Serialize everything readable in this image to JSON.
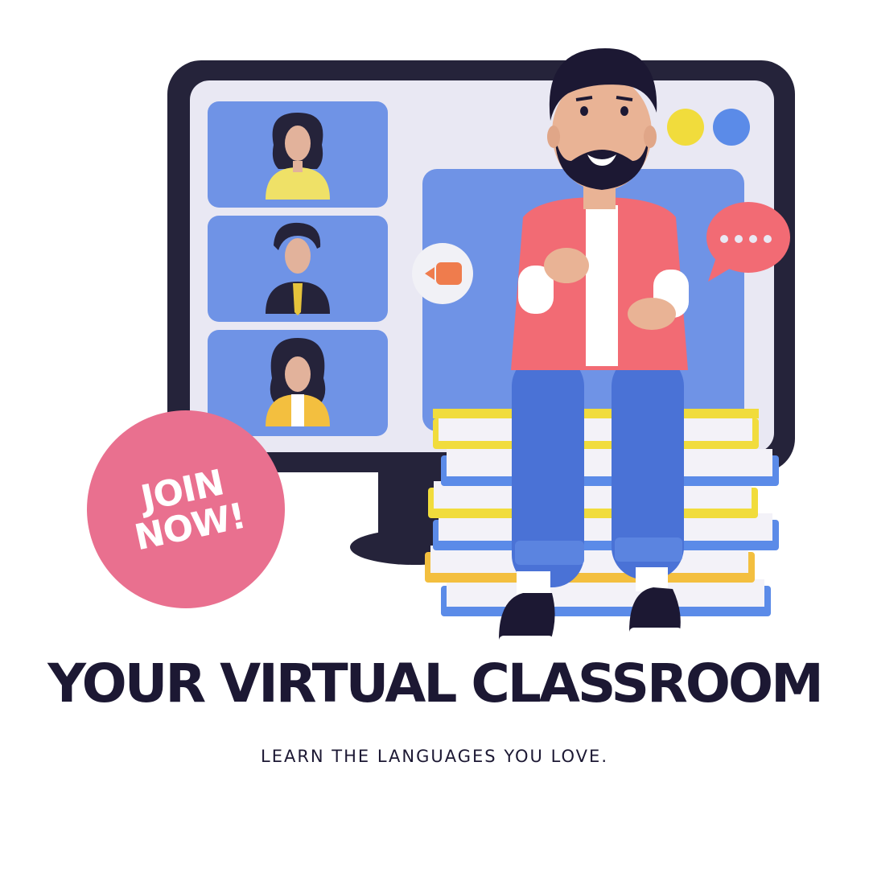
{
  "badge": {
    "line1": "JOIN",
    "line2": "NOW!"
  },
  "headline": "YOUR VIRTUAL CLASSROOM",
  "tagline": "LEARN THE LANGUAGES YOU LOVE.",
  "colors": {
    "badge": "#e9708f",
    "text": "#1c1833",
    "monitor_frame": "#25233a",
    "tile_blue": "#6f93e6",
    "shirt": "#f26b74",
    "jeans": "#4a72d6",
    "yellow_dot": "#f1dc3c",
    "blue_dot": "#5b8be8"
  },
  "icons": [
    "video-camera-icon",
    "chat-bubble-icon"
  ]
}
